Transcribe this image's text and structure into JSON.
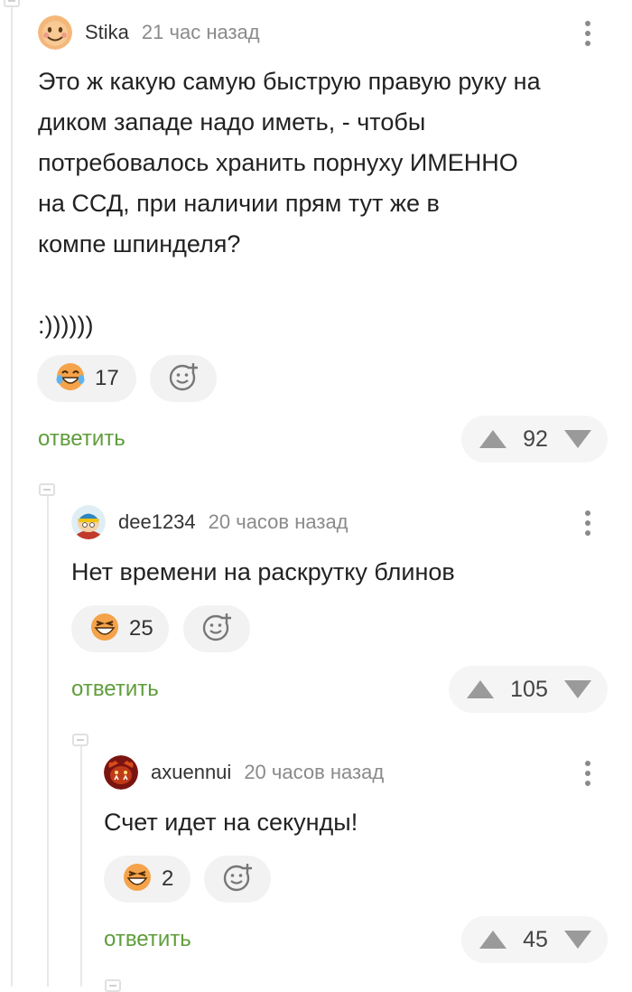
{
  "comments": [
    {
      "username": "Stika",
      "time": "21 час назад",
      "text": "Это ж какую самую быструю правую руку на\nдиком западе надо иметь, - чтобы\nпотребовалось хранить порнуху ИМЕННО\nна ССД, при наличии прям тут же в\nкомпе шпинделя?\n\n:))))))",
      "reaction_icon": "laughing-tears-emoji-icon",
      "reaction_count": "17",
      "reply_label": "ответить",
      "score": "92"
    },
    {
      "username": "dee1234",
      "time": "20 часов назад",
      "text": "Нет времени на раскрутку блинов",
      "reaction_icon": "grinning-squint-emoji-icon",
      "reaction_count": "25",
      "reply_label": "ответить",
      "score": "105"
    },
    {
      "username": "axuennui",
      "time": "20 часов назад",
      "text": "Счет идет на секунды!",
      "reaction_icon": "grinning-squint-emoji-icon",
      "reaction_count": "2",
      "reply_label": "ответить",
      "score": "45"
    }
  ],
  "colors": {
    "reply_green": "#5f9d3b",
    "pill_bg": "#f2f2f2",
    "muted_gray": "#8a8a8a",
    "emoji_orange": "#f5a34a"
  }
}
